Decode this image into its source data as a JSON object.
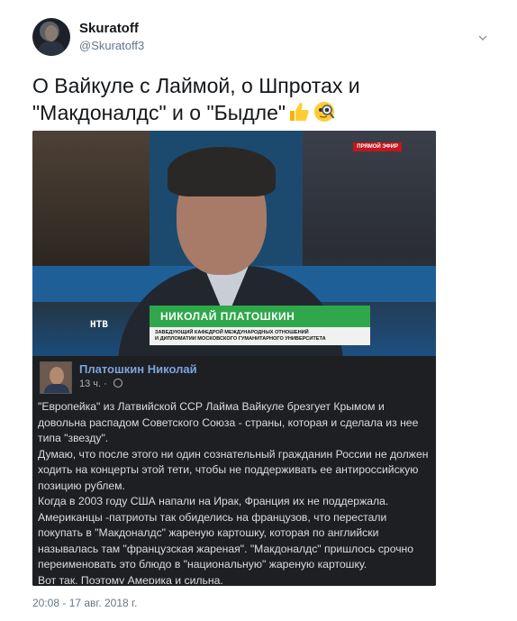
{
  "user": {
    "display_name": "Skuratoff",
    "handle": "@Skuratoff3"
  },
  "tweet": {
    "text": "О Вайкуле с Лаймой, о Шпротах и \"Макдоналдс\" и о \"Быдле\"",
    "emoji": [
      "thumbs-up",
      "magnifier-eyes"
    ],
    "timestamp": "20:08 - 17 авг. 2018 г."
  },
  "media": {
    "live_badge": "ПРЯМОЙ ЭФИР",
    "channel_logo": "НТВ",
    "lower_third_name": "НИКОЛАЙ ПЛАТОШКИН",
    "lower_third_title_line1": "ЗАВЕДУЮЩИЙ КАФЕДРОЙ МЕЖДУНАРОДНЫХ ОТНОШЕНИЙ",
    "lower_third_title_line2": "И ДИПЛОМАТИИ МОСКОВСКОГО ГУМАНИТАРНОГО УНИВЕРСИТЕТА"
  },
  "post": {
    "author": "Платошкин Николай",
    "time": "13 ч. ·",
    "paragraphs": [
      "\"Европейка\" из Латвийской ССР Лайма Вайкуле брезгует Крымом и довольна распадом Советского Союза - страны, которая и сделала из нее типа \"звезду\".",
      "Думаю, что после этого ни один сознательный гражданин России не должен ходить на концерты этой тети, чтобы не поддерживать ее антироссийскую позицию рублем.",
      "Когда в 2003 году США напали на Ирак, Франция их не поддержала. Американцы -патриоты так обиделись на французов, что перестали покупать в \"Макдоналдс\" жареную картошку, которая по английски называлась там \"французская жареная\". \"Макдоналдс\" пришлось срочно переименовать это блюдо в \"национальную\" жареную картошку.",
      "Вот так. Поэтому Америка и сильна."
    ]
  }
}
